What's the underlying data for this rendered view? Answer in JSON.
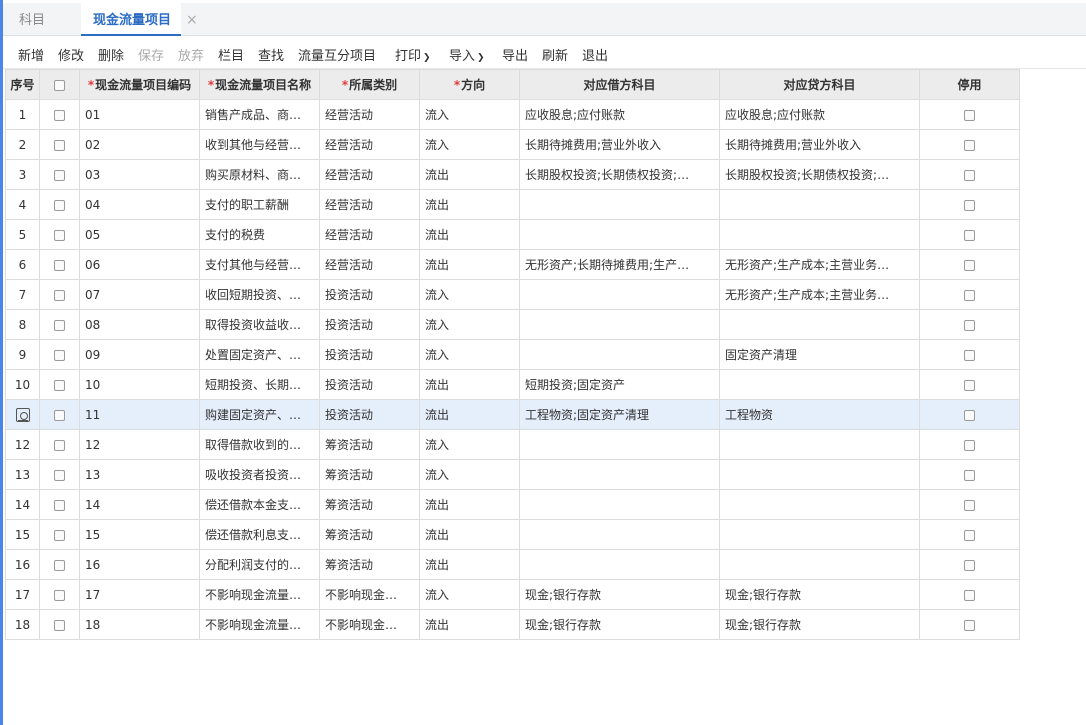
{
  "tabs": [
    {
      "label": "科目",
      "active": false
    },
    {
      "label": "现金流量项目",
      "active": true
    }
  ],
  "tab_close_icon": "×",
  "toolbar": {
    "new": "新增",
    "edit": "修改",
    "delete": "删除",
    "save": "保存",
    "discard": "放弃",
    "columns": "栏目",
    "find": "查找",
    "flow_split": "流量互分项目",
    "print": "打印",
    "import": "导入",
    "export": "导出",
    "refresh": "刷新",
    "exit": "退出"
  },
  "columns": {
    "index": "序号",
    "code": "现金流量项目编码",
    "name": "现金流量项目名称",
    "category": "所属类别",
    "direction": "方向",
    "debit": "对应借方科目",
    "credit": "对应贷方科目",
    "disabled": "停用"
  },
  "rows": [
    {
      "index": "1",
      "code": "01",
      "name": "销售产成品、商…",
      "category": "经营活动",
      "direction": "流入",
      "debit": "应收股息;应付账款",
      "credit": "应收股息;应付账款"
    },
    {
      "index": "2",
      "code": "02",
      "name": "收到其他与经营…",
      "category": "经营活动",
      "direction": "流入",
      "debit": "长期待摊费用;营业外收入",
      "credit": "长期待摊费用;营业外收入"
    },
    {
      "index": "3",
      "code": "03",
      "name": "购买原材料、商…",
      "category": "经营活动",
      "direction": "流出",
      "debit": "长期股权投资;长期债权投资;…",
      "credit": "长期股权投资;长期债权投资;…"
    },
    {
      "index": "4",
      "code": "04",
      "name": "支付的职工薪酬",
      "category": "经营活动",
      "direction": "流出",
      "debit": "",
      "credit": ""
    },
    {
      "index": "5",
      "code": "05",
      "name": "支付的税费",
      "category": "经营活动",
      "direction": "流出",
      "debit": "",
      "credit": ""
    },
    {
      "index": "6",
      "code": "06",
      "name": "支付其他与经营…",
      "category": "经营活动",
      "direction": "流出",
      "debit": "无形资产;长期待摊费用;生产…",
      "credit": "无形资产;生产成本;主营业务…"
    },
    {
      "index": "7",
      "code": "07",
      "name": "收回短期投资、…",
      "category": "投资活动",
      "direction": "流入",
      "debit": "",
      "credit": "无形资产;生产成本;主营业务…"
    },
    {
      "index": "8",
      "code": "08",
      "name": "取得投资收益收…",
      "category": "投资活动",
      "direction": "流入",
      "debit": "",
      "credit": ""
    },
    {
      "index": "9",
      "code": "09",
      "name": "处置固定资产、…",
      "category": "投资活动",
      "direction": "流入",
      "debit": "",
      "credit": "固定资产清理"
    },
    {
      "index": "10",
      "code": "10",
      "name": "短期投资、长期…",
      "category": "投资活动",
      "direction": "流出",
      "debit": "短期投资;固定资产",
      "credit": ""
    },
    {
      "index": "",
      "code": "11",
      "name": "购建固定资产、…",
      "category": "投资活动",
      "direction": "流出",
      "debit": "工程物资;固定资产清理",
      "credit": "工程物资",
      "selected": true
    },
    {
      "index": "12",
      "code": "12",
      "name": "取得借款收到的…",
      "category": "筹资活动",
      "direction": "流入",
      "debit": "",
      "credit": ""
    },
    {
      "index": "13",
      "code": "13",
      "name": "吸收投资者投资…",
      "category": "筹资活动",
      "direction": "流入",
      "debit": "",
      "credit": ""
    },
    {
      "index": "14",
      "code": "14",
      "name": "偿还借款本金支…",
      "category": "筹资活动",
      "direction": "流出",
      "debit": "",
      "credit": ""
    },
    {
      "index": "15",
      "code": "15",
      "name": "偿还借款利息支…",
      "category": "筹资活动",
      "direction": "流出",
      "debit": "",
      "credit": ""
    },
    {
      "index": "16",
      "code": "16",
      "name": "分配利润支付的…",
      "category": "筹资活动",
      "direction": "流出",
      "debit": "",
      "credit": ""
    },
    {
      "index": "17",
      "code": "17",
      "name": "不影响现金流量…",
      "category": "不影响现金…",
      "direction": "流入",
      "debit": "现金;银行存款",
      "credit": "现金;银行存款"
    },
    {
      "index": "18",
      "code": "18",
      "name": "不影响现金流量…",
      "category": "不影响现金…",
      "direction": "流出",
      "debit": "现金;银行存款",
      "credit": "现金;银行存款"
    }
  ],
  "colors": {
    "accent": "#2b6cc4",
    "selected_row": "#e5eefb",
    "required": "#e03c3c"
  }
}
